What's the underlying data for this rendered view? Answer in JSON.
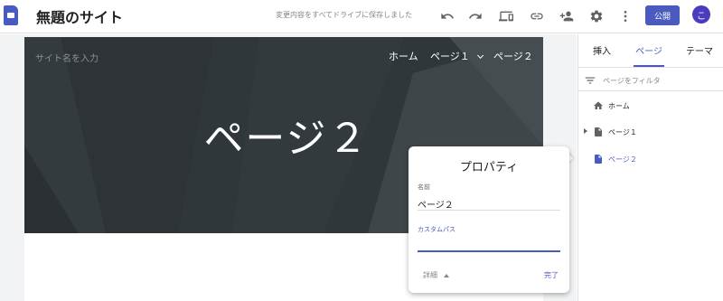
{
  "header": {
    "site_title": "無題のサイト",
    "save_status": "変更内容をすべてドライブに保存しました",
    "publish_label": "公開",
    "avatar_letter": "こ",
    "icons": [
      "undo-icon",
      "redo-icon",
      "preview-icon",
      "link-icon",
      "share-icon",
      "settings-icon",
      "more-icon"
    ]
  },
  "hero": {
    "site_name_placeholder": "サイト名を入力",
    "title": "ページ２",
    "nav": [
      {
        "label": "ホーム"
      },
      {
        "label": "ページ１"
      },
      {
        "label": "ページ２"
      }
    ]
  },
  "properties": {
    "title": "プロパティ",
    "name_label": "名前",
    "name_value": "ページ２",
    "path_label": "カスタムパス",
    "path_value": "",
    "details_label": "詳細",
    "done_label": "完了"
  },
  "sidepanel": {
    "tabs": [
      {
        "label": "挿入"
      },
      {
        "label": "ページ"
      },
      {
        "label": "テーマ"
      }
    ],
    "active_tab": "ページ",
    "filter_placeholder": "ページをフィルタ",
    "pages": [
      {
        "label": "ホーム",
        "icon": "home-icon"
      },
      {
        "label": "ページ１",
        "icon": "page-icon"
      },
      {
        "label": "ページ２",
        "icon": "page-icon"
      }
    ]
  },
  "colors": {
    "accent": "#4a5bbf",
    "hero_bg": "#353d40"
  }
}
